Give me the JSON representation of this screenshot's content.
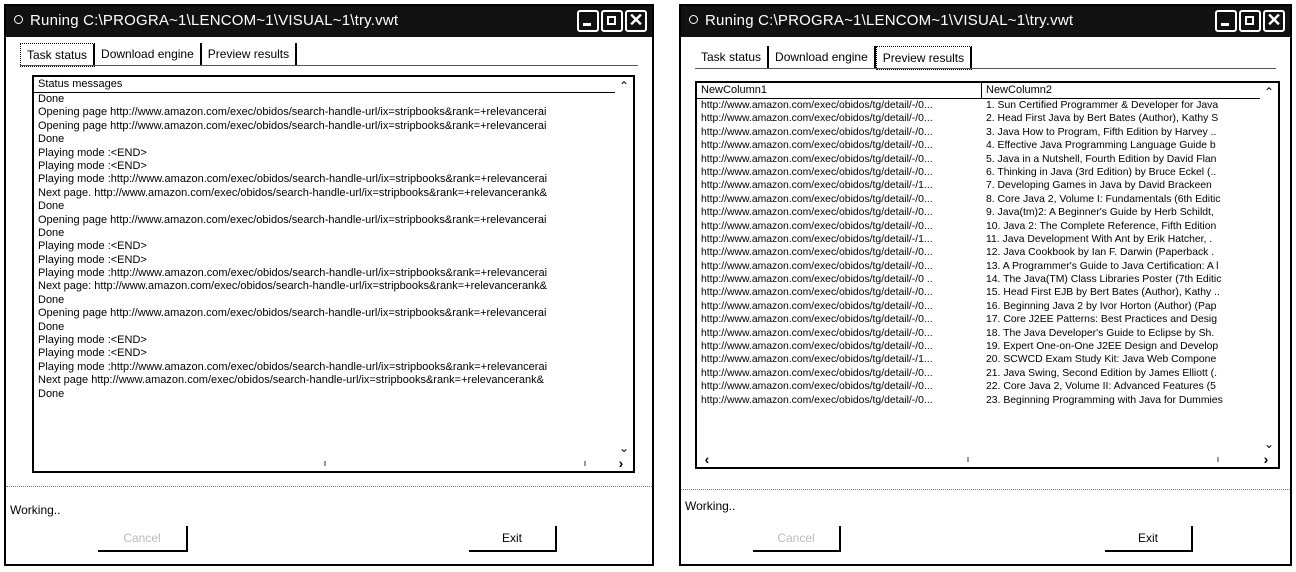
{
  "left_window": {
    "title": "Runing C:\\PROGRA~1\\LENCOM~1\\VISUAL~1\\try.vwt",
    "tabs": [
      "Task status",
      "Download engine",
      "Preview results"
    ],
    "active_tab": "Task status",
    "list_header": "Status messages",
    "messages": [
      "Done",
      "Opening page http://www.amazon.com/exec/obidos/search-handle-url/ix=stripbooks&rank=+relevancerai",
      "Opening page http://www.amazon.com/exec/obidos/search-handle-url/ix=stripbooks&rank=+relevancerai",
      "Done",
      "Playing mode :<END>",
      "Playing mode :<END>",
      "Playing mode :http://www.amazon.com/exec/obidos/search-handle-url/ix=stripbooks&rank=+relevancerai",
      "Next page. http://www.amazon.com/exec/obidos/search-handle-url/ix=stripbooks&rank=+relevancerank&",
      "Done",
      "Opening page http://www.amazon.com/exec/obidos/search-handle-url/ix=stripbooks&rank=+relevancerai",
      "Done",
      "Playing mode :<END>",
      "Playing mode :<END>",
      "Playing mode :http://www.amazon.com/exec/obidos/search-handle-url/ix=stripbooks&rank=+relevancerai",
      "Next page: http://www.amazon.com/exec/obidos/search-handle-url/ix=stripbooks&rank=+relevancerank&",
      "Done",
      "Opening page http://www.amazon.com/exec/obidos/search-handle-url/ix=stripbooks&rank=+relevancerai",
      "Done",
      "Playing mode :<END>",
      "Playing mode :<END>",
      "Playing mode :http://www.amazon.com/exec/obidos/search-handle-url/ix=stripbooks&rank=+relevancerai",
      "Next page  http://www.amazon.com/exec/obidos/search-handle-url/ix=stripbooks&rank=+relevancerank&",
      "Done"
    ],
    "status": "Working..",
    "left_button": "Cancel",
    "exit_button": "Exit"
  },
  "right_window": {
    "title": "Runing C:\\PROGRA~1\\LENCOM~1\\VISUAL~1\\try.vwt",
    "tabs": [
      "Task status",
      "Download engine",
      "Preview results"
    ],
    "active_tab": "Preview results",
    "columns": [
      "NewColumn1",
      "NewColumn2"
    ],
    "rows": [
      [
        "http://www.amazon.com/exec/obidos/tg/detail/-/0...",
        "1. Sun Certified Programmer & Developer for Java"
      ],
      [
        "http://www.amazon.com/exec/obidos/tg/detail/-/0...",
        "2. Head First Java by Bert Bates (Author), Kathy S"
      ],
      [
        "http://www.amazon.com/exec/obidos/tg/detail/-/0...",
        "3. Java How to Program, Fifth Edition by Harvey .."
      ],
      [
        "http://www.amazon.com/exec/obidos/tg/detail/-/0...",
        "4. Effective Java Programming Language Guide b"
      ],
      [
        "http://www.amazon.com/exec/obidos/tg/detail/-/0...",
        "5. Java in a Nutshell, Fourth Edition by David Flan"
      ],
      [
        "http://www.amazon.com/exec/obidos/tg/detail/-/0...",
        "6. Thinking in Java (3rd Edition) by Bruce Eckel (.."
      ],
      [
        "http://www.amazon.com/exec/obidos/tg/detail/-/1...",
        "7. Developing Games in Java by David Brackeen"
      ],
      [
        "http://www.amazon.com/exec/obidos/tg/detail/-/0...",
        "8. Core Java 2, Volume I: Fundamentals (6th Editic"
      ],
      [
        "http://www.amazon.com/exec/obidos/tg/detail/-/0...",
        "9. Java(tm)2: A Beginner's Guide by Herb Schildt,"
      ],
      [
        "http://www.amazon.com/exec/obidos/tg/detail/-/0...",
        "10. Java 2: The Complete Reference, Fifth Edition"
      ],
      [
        "http://www.amazon.com/exec/obidos/tg/detail/-/1...",
        "11. Java Development With Ant by Erik Hatcher, ."
      ],
      [
        "http://www.amazon.com/exec/obidos/tg/detail/-/0...",
        "12. Java Cookbook by Ian F. Darwin (Paperback ."
      ],
      [
        "http://www.amazon.com/exec/obidos/tg/detail/-/0...",
        "13. A Programmer's Guide to Java Certification: A l"
      ],
      [
        "http://www.amazon.com/exec/obidos/tg/detail/-/0 ..",
        "14. The Java(TM) Class Libraries Poster (7th Editic"
      ],
      [
        "http://www.amazon.com/exec/obidos/tg/detail/-/0...",
        "15. Head First EJB by Bert Bates (Author), Kathy .."
      ],
      [
        "http://www.amazon.com/exec/obidos/tg/detail/-/0...",
        "16. Beginning Java 2 by Ivor Horton (Author) (Pap"
      ],
      [
        "http://www.amazon.com/exec/obidos/tg/detail/-/0...",
        "17. Core J2EE Patterns: Best Practices and Desig"
      ],
      [
        "http://www.amazon.com/exec/obidos/tg/detail/-/0...",
        "18. The Java Developer's Guide to Eclipse by Sh."
      ],
      [
        "http://www.amazon.com/exec/obidos/tg/detail/-/0...",
        "19. Expert One-on-One J2EE Design and Develop"
      ],
      [
        "http://www.amazon.com/exec/obidos/tg/detail/-/1...",
        "20. SCWCD Exam Study Kit: Java Web Compone"
      ],
      [
        "http://www.amazon.com/exec/obidos/tg/detail/-/0...",
        "21. Java Swing, Second Edition by James Elliott (."
      ],
      [
        "http://www.amazon.com/exec/obidos/tg/detail/-/0...",
        "22. Core Java 2, Volume II: Advanced Features (5"
      ],
      [
        "http://www.amazon.com/exec/obidos/tg/detail/-/0...",
        "23. Beginning Programming with Java for Dummies"
      ]
    ],
    "status": "Working..",
    "left_button": "Cancel",
    "exit_button": "Exit"
  }
}
